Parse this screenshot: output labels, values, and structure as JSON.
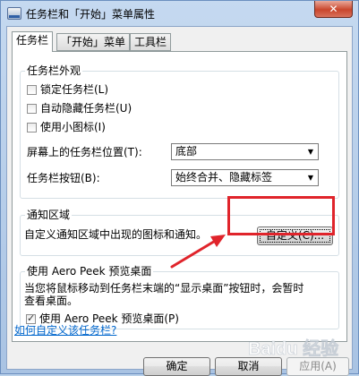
{
  "window": {
    "title": "任务栏和「开始」菜单属性",
    "close_glyph": "✕"
  },
  "tabs": [
    {
      "label": "任务栏",
      "active": true
    },
    {
      "label": "「开始」菜单",
      "active": false
    },
    {
      "label": "工具栏",
      "active": false
    }
  ],
  "appearance": {
    "legend": "任务栏外观",
    "checkboxes": [
      {
        "label": "锁定任务栏(L)",
        "checked": false
      },
      {
        "label": "自动隐藏任务栏(U)",
        "checked": false
      },
      {
        "label": "使用小图标(I)",
        "checked": false
      }
    ],
    "position_label": "屏幕上的任务栏位置(T):",
    "position_value": "底部",
    "buttons_label": "任务栏按钮(B):",
    "buttons_value": "始终合并、隐藏标签"
  },
  "notification": {
    "legend": "通知区域",
    "text": "自定义通知区域中出现的图标和通知。",
    "customize_label": "自定义(C)..."
  },
  "peek": {
    "legend": "使用 Aero Peek 预览桌面",
    "description_line1": "当您将鼠标移动到任务栏末端的“显示桌面”按钮时，会暂时",
    "description_line2": "查看桌面。",
    "checkbox_label": "使用 Aero Peek 预览桌面(P)",
    "checkbox_checked": true
  },
  "help_link": "如何自定义该任务栏?",
  "footer": {
    "ok_label": "确定",
    "cancel_label": "取消",
    "apply_label": "应用(A)"
  },
  "watermark": "Baidu 经验",
  "colors": {
    "annotation_red": "#e0242b",
    "link_blue": "#0066cc"
  }
}
